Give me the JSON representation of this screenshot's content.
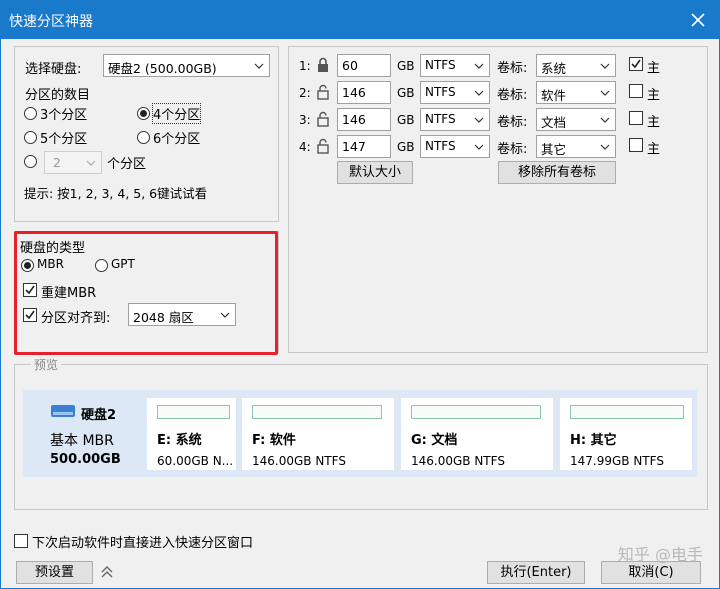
{
  "window": {
    "title": "快速分区神器"
  },
  "disk_select": {
    "label": "选择硬盘:",
    "value": "硬盘2 (500.00GB)"
  },
  "partition_count": {
    "label": "分区的数目",
    "options": [
      "3个分区",
      "4个分区",
      "5个分区",
      "6个分区"
    ],
    "selected": "4个分区",
    "custom_value": "2",
    "custom_suffix": "个分区"
  },
  "hint": "提示: 按1, 2, 3, 4, 5, 6键试试看",
  "disk_type": {
    "label": "硬盘的类型",
    "mbr_label": "MBR",
    "gpt_label": "GPT",
    "selected": "MBR",
    "rebuild_mbr_label": "重建MBR",
    "rebuild_mbr_checked": true,
    "align_label": "分区对齐到:",
    "align_checked": true,
    "align_value": "2048 扇区"
  },
  "partitions": [
    {
      "num": "1:",
      "size": "60",
      "unit": "GB",
      "fs": "NTFS",
      "vol_label": "卷标:",
      "volume": "系统",
      "primary_label": "主",
      "primary": true,
      "locked": true
    },
    {
      "num": "2:",
      "size": "146",
      "unit": "GB",
      "fs": "NTFS",
      "vol_label": "卷标:",
      "volume": "软件",
      "primary_label": "主",
      "primary": false,
      "locked": false
    },
    {
      "num": "3:",
      "size": "146",
      "unit": "GB",
      "fs": "NTFS",
      "vol_label": "卷标:",
      "volume": "文档",
      "primary_label": "主",
      "primary": false,
      "locked": false
    },
    {
      "num": "4:",
      "size": "147",
      "unit": "GB",
      "fs": "NTFS",
      "vol_label": "卷标:",
      "volume": "其它",
      "primary_label": "主",
      "primary": false,
      "locked": false
    }
  ],
  "buttons": {
    "default_size": "默认大小",
    "remove_labels": "移除所有卷标",
    "preset": "预设置",
    "execute": "执行(Enter)",
    "cancel": "取消(C)"
  },
  "preview": {
    "label": "预览",
    "disk_name": "硬盘2",
    "disk_type": "基本 MBR",
    "disk_size": "500.00GB",
    "parts": [
      {
        "name": "E: 系统",
        "info": "60.00GB N..."
      },
      {
        "name": "F: 软件",
        "info": "146.00GB NTFS"
      },
      {
        "name": "G: 文档",
        "info": "146.00GB NTFS"
      },
      {
        "name": "H: 其它",
        "info": "147.99GB NTFS"
      }
    ]
  },
  "startup_checkbox": {
    "label": "下次启动软件时直接进入快速分区窗口",
    "checked": false
  },
  "watermark": "知乎 @电手",
  "colors": {
    "titlebar": "#1979ca",
    "highlight": "#e8202a",
    "preview_bg": "#dce8f5",
    "part_bar": "#8bc9a8"
  }
}
